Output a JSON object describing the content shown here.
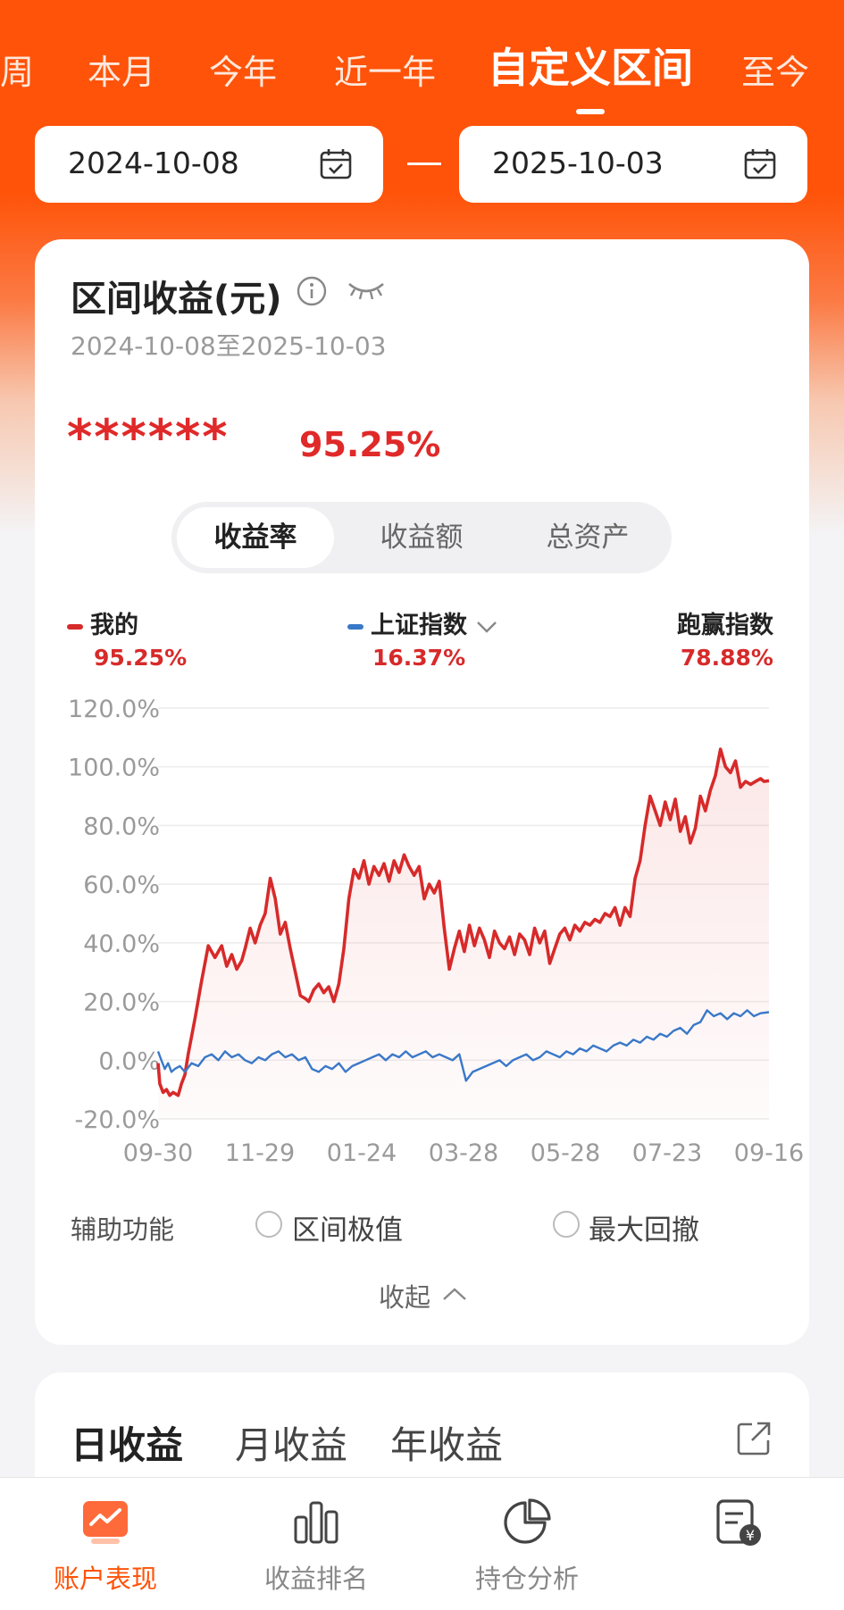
{
  "period_tabs": [
    {
      "label": "周",
      "active": false
    },
    {
      "label": "本月",
      "active": false
    },
    {
      "label": "今年",
      "active": false
    },
    {
      "label": "近一年",
      "active": false
    },
    {
      "label": "自定义区间",
      "active": true
    },
    {
      "label": "至今",
      "active": false
    }
  ],
  "date_range": {
    "start": "2024-10-08",
    "end": "2025-10-03"
  },
  "card": {
    "title": "区间收益(元)",
    "subtitle": "2024-10-08至2025-10-03",
    "masked_amount": "******",
    "return_pct": "95.25%"
  },
  "segment": {
    "items": [
      "收益率",
      "收益额",
      "总资产"
    ],
    "active_index": 0
  },
  "legend": {
    "mine": {
      "label": "我的",
      "value": "95.25%"
    },
    "index": {
      "label": "上证指数",
      "value": "16.37%"
    },
    "beat": {
      "label": "跑赢指数",
      "value": "78.88%"
    }
  },
  "colors": {
    "brand": "#ff5309",
    "mine": "#d72a2a",
    "index": "#3a78c8",
    "text": "#222222"
  },
  "chart_data": {
    "type": "line",
    "title": "",
    "xlabel": "",
    "ylabel": "",
    "x_ticks": [
      "09-30",
      "11-29",
      "01-24",
      "03-28",
      "05-28",
      "07-23",
      "09-16"
    ],
    "y_ticks": [
      "120.0%",
      "100.0%",
      "80.0%",
      "60.0%",
      "40.0%",
      "20.0%",
      "0.0%",
      "-20.0%"
    ],
    "ylim": [
      -20,
      120
    ],
    "grid": true,
    "legend": "top",
    "x_range": [
      0,
      365
    ],
    "series": [
      {
        "name": "我的",
        "x": [
          0,
          1,
          3,
          5,
          7,
          9,
          12,
          14,
          16,
          18,
          22,
          26,
          30,
          34,
          38,
          41,
          44,
          47,
          50,
          52,
          55,
          58,
          61,
          64,
          67,
          70,
          73,
          76,
          79,
          82,
          85,
          88,
          90,
          93,
          96,
          99,
          102,
          105,
          108,
          111,
          114,
          117,
          120,
          123,
          126,
          129,
          132,
          135,
          138,
          141,
          144,
          147,
          150,
          153,
          156,
          159,
          162,
          165,
          168,
          171,
          174,
          177,
          180,
          183,
          186,
          189,
          192,
          195,
          198,
          201,
          204,
          207,
          210,
          213,
          216,
          219,
          222,
          225,
          228,
          231,
          234,
          237,
          240,
          243,
          246,
          249,
          252,
          255,
          258,
          261,
          264,
          267,
          270,
          273,
          276,
          279,
          282,
          285,
          288,
          291,
          294,
          297,
          300,
          303,
          306,
          309,
          312,
          315,
          318,
          321,
          324,
          327,
          330,
          333,
          336,
          339,
          342,
          345,
          348,
          351,
          354,
          357,
          360,
          362,
          365
        ],
        "values": [
          -1,
          -8,
          -11,
          -10,
          -12,
          -11,
          -12,
          -8,
          -5,
          2,
          14,
          27,
          39,
          35,
          39,
          32,
          36,
          31,
          34,
          38,
          45,
          40,
          46,
          50,
          62,
          55,
          43,
          47,
          38,
          30,
          22,
          21,
          20,
          24,
          26,
          23,
          25,
          20,
          26,
          38,
          55,
          65,
          62,
          68,
          60,
          66,
          63,
          67,
          61,
          68,
          64,
          70,
          66,
          63,
          66,
          55,
          60,
          57,
          61,
          45,
          31,
          38,
          44,
          37,
          46,
          39,
          45,
          41,
          35,
          44,
          40,
          38,
          42,
          36,
          43,
          41,
          36,
          45,
          40,
          44,
          33,
          38,
          43,
          45,
          41,
          46,
          44,
          47,
          46,
          48,
          47,
          50,
          49,
          52,
          46,
          52,
          49,
          62,
          68,
          80,
          90,
          85,
          80,
          88,
          82,
          89,
          78,
          83,
          74,
          79,
          90,
          85,
          92,
          97,
          106,
          100,
          98,
          102,
          93,
          95,
          94,
          95,
          96,
          95,
          95.25
        ]
      },
      {
        "name": "上证指数",
        "x": [
          0,
          2,
          4,
          6,
          8,
          10,
          13,
          16,
          20,
          24,
          28,
          32,
          36,
          40,
          44,
          48,
          52,
          56,
          60,
          64,
          68,
          72,
          76,
          80,
          84,
          88,
          92,
          96,
          100,
          104,
          108,
          112,
          116,
          120,
          124,
          128,
          132,
          136,
          140,
          144,
          148,
          152,
          156,
          160,
          164,
          168,
          172,
          176,
          180,
          184,
          188,
          192,
          196,
          200,
          204,
          208,
          212,
          216,
          220,
          224,
          228,
          232,
          236,
          240,
          244,
          248,
          252,
          256,
          260,
          264,
          268,
          272,
          276,
          280,
          284,
          288,
          292,
          296,
          300,
          304,
          308,
          312,
          316,
          320,
          324,
          328,
          332,
          336,
          340,
          344,
          348,
          352,
          356,
          360,
          365
        ],
        "values": [
          3,
          0,
          -3,
          -1,
          -4,
          -3,
          -2,
          -4,
          -1,
          -2,
          1,
          2,
          0,
          3,
          1,
          2,
          0,
          -1,
          1,
          0,
          2,
          3,
          1,
          2,
          0,
          1,
          -3,
          -4,
          -2,
          -3,
          -1,
          -4,
          -2,
          -1,
          0,
          1,
          2,
          0,
          2,
          1,
          3,
          1,
          2,
          3,
          1,
          2,
          1,
          0,
          2,
          -7,
          -4,
          -3,
          -2,
          -1,
          0,
          -2,
          0,
          1,
          2,
          0,
          1,
          3,
          2,
          1,
          3,
          2,
          4,
          3,
          5,
          4,
          3,
          5,
          6,
          5,
          7,
          6,
          8,
          7,
          9,
          8,
          10,
          11,
          9,
          12,
          13,
          17,
          15,
          16,
          14,
          16,
          15,
          17,
          15,
          16,
          16.37
        ]
      }
    ]
  },
  "aux": {
    "label": "辅助功能",
    "option1": "区间极值",
    "option2": "最大回撤"
  },
  "collapse_label": "收起",
  "earnings_tabs": [
    {
      "label": "日收益",
      "active": true
    },
    {
      "label": "月收益",
      "active": false
    },
    {
      "label": "年收益",
      "active": false
    }
  ],
  "bottom_nav": [
    {
      "label": "账户表现",
      "icon": "account-chart-icon",
      "active": true
    },
    {
      "label": "收益排名",
      "icon": "bar-chart-icon",
      "active": false
    },
    {
      "label": "持仓分析",
      "icon": "pie-chart-icon",
      "active": false
    },
    {
      "label": "",
      "icon": "bill-yuan-icon",
      "active": false
    }
  ]
}
